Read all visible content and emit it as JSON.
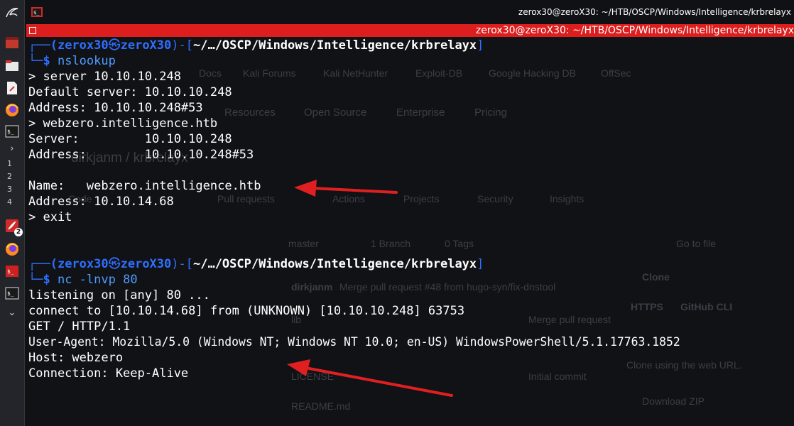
{
  "window": {
    "title": "zerox30@zeroX30: ~/HTB/OSCP/Windows/Intelligence/krbrelayx",
    "title_red": "zerox30@zeroX30: ~/HTB/OSCP/Windows/Intelligence/krbrelayx"
  },
  "dock": {
    "workspaces": [
      "1",
      "2",
      "3",
      "4"
    ],
    "badge_count": "2",
    "icons": [
      "kali-dragon-icon",
      "app-icon",
      "files-icon",
      "text-editor-icon",
      "firefox-icon",
      "terminal-icon",
      "chevron-right-icon",
      "pdf-icon",
      "firefox-icon",
      "terminal-root-icon",
      "terminal-icon",
      "chevron-down-icon"
    ]
  },
  "background": {
    "ghost_texts": [
      "Docs",
      "Kali Forums",
      "Kali NetHunter",
      "Exploit-DB",
      "Google Hacking DB",
      "OffSec",
      "Resources",
      "Open Source",
      "Enterprise",
      "Pricing",
      "dirkjanm / krbrelayx",
      "Code",
      "Pull requests",
      "Actions",
      "Projects",
      "Security",
      "Insights",
      "master",
      "1 Branch",
      "0 Tags",
      "Go to file",
      "Clone",
      "HTTPS",
      "GitHub CLI",
      "dirkjanm",
      "Merge pull request #48 from hugo-syn/fix-dnstool",
      "lib",
      "LICENSE",
      "README.md",
      "Merge pull request",
      "Initial commit",
      "Clone using the web URL.",
      "Download ZIP"
    ]
  },
  "session1": {
    "prompt_user": "(zerox30",
    "prompt_at": "㉿",
    "prompt_host": "zeroX30",
    "prompt_close": ")-[",
    "prompt_path": "~/…/OSCP/Windows/Intelligence/krbrelayx",
    "prompt_end": "]",
    "prompt_corner_top": "┌──",
    "prompt_corner_bottom": "└─",
    "prompt_dollar": "$ ",
    "command": "nslookup",
    "output": [
      "> server 10.10.10.248",
      "Default server: 10.10.10.248",
      "Address: 10.10.10.248#53",
      "> webzero.intelligence.htb",
      "Server:         10.10.10.248",
      "Address:        10.10.10.248#53",
      "",
      "Name:   webzero.intelligence.htb",
      "Address: 10.10.14.68",
      "> exit"
    ]
  },
  "session2": {
    "prompt_user": "(zerox30",
    "prompt_at": "㉿",
    "prompt_host": "zeroX30",
    "prompt_close": ")-[",
    "prompt_path": "~/…/OSCP/Windows/Intelligence/krbrelayx",
    "prompt_end": "]",
    "prompt_corner_top": "┌──",
    "prompt_corner_bottom": "└─",
    "prompt_dollar": "$ ",
    "command": "nc -lnvp 80",
    "output": [
      "listening on [any] 80 ...",
      "connect to [10.10.14.68] from (UNKNOWN) [10.10.10.248] 63753",
      "GET / HTTP/1.1",
      "User-Agent: Mozilla/5.0 (Windows NT; Windows NT 10.0; en-US) WindowsPowerShell/5.1.17763.1852",
      "Host: webzero",
      "Connection: Keep-Alive"
    ]
  },
  "colors": {
    "prompt_blue": "#2f6fff",
    "annotation_red": "#e02020",
    "titlebar_red": "#dc1e1e"
  }
}
